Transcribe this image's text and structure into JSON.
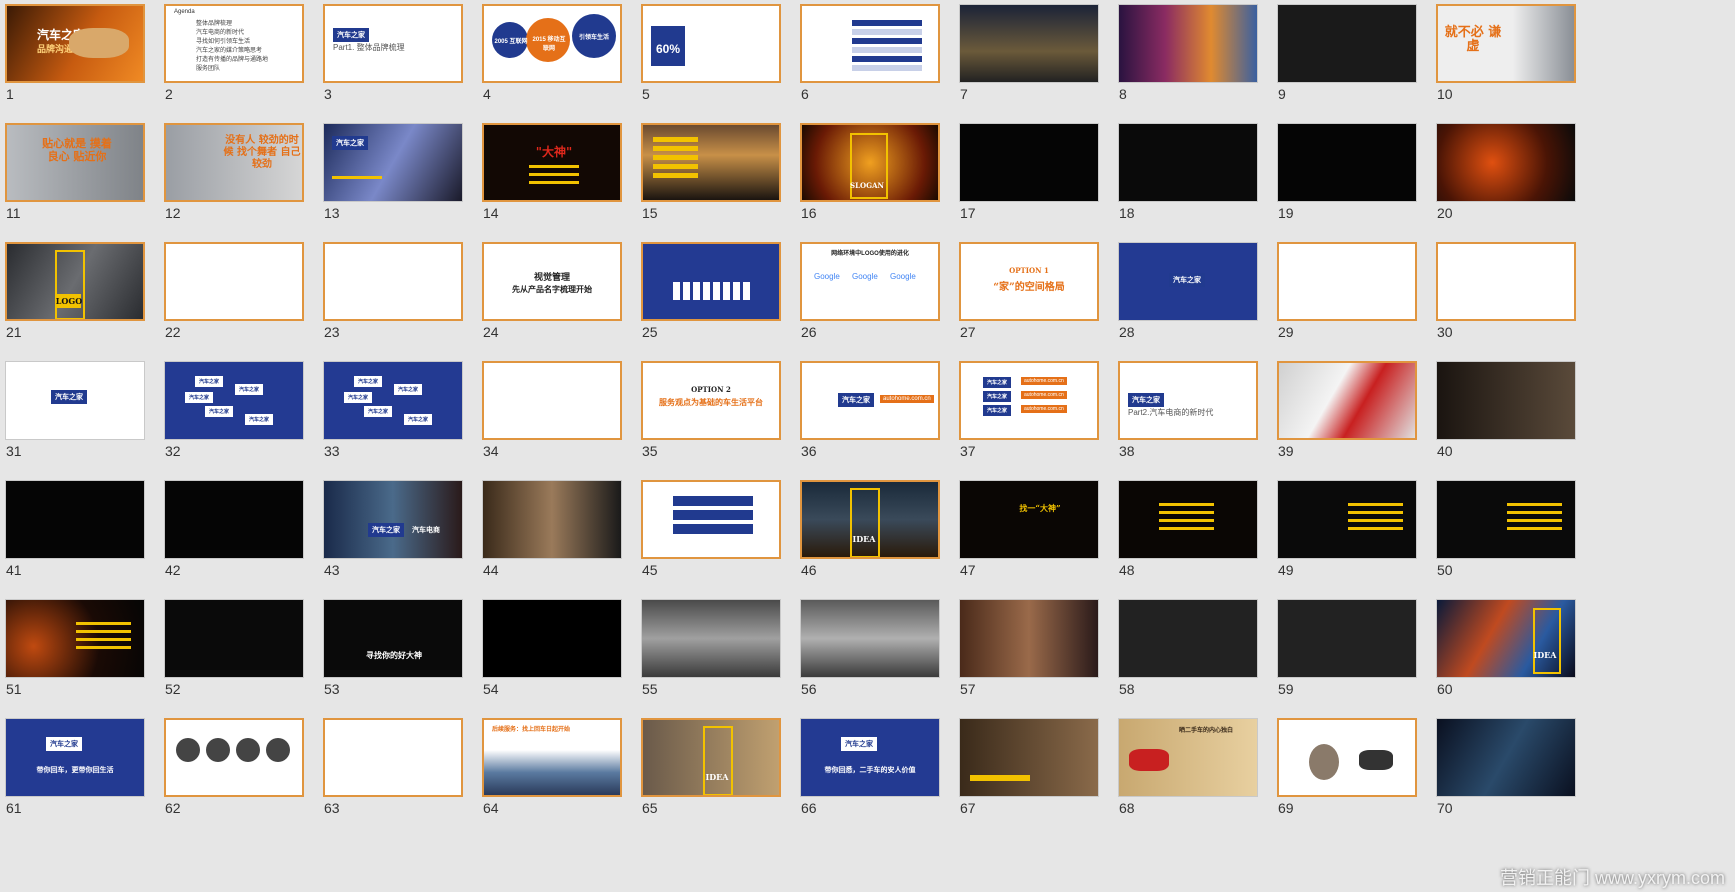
{
  "agenda": {
    "title": "Agenda",
    "items": [
      "整体品牌梳理",
      "汽车电商的新时代",
      "寻找如何引领车生活",
      "汽车之家的媒介策略思考",
      "打造有传播的品牌与通路地",
      "服务团队"
    ]
  },
  "slide_text": {
    "s1_title": "汽车之家",
    "s1_sub": "品牌沟通方案",
    "s3_part": "Part1. 整体品牌梳理",
    "s4_a": "2005 互联网",
    "s4_b": "2015 移动互联网",
    "s4_c": "引领车生活",
    "s5_big": "60%",
    "s10_big": "就不必 谦虚",
    "s11_big": "贴心就是 摸着良心 贴近你",
    "s12_big": "没有人 较劲的时候 找个舞者 自己较劲",
    "s14_big": "\"大神\"",
    "s16_big": "SLOGAN",
    "s21_big": "LOGO",
    "s24_line1": "视觉管理",
    "s24_line2": "先从产品名字梳理开始",
    "s26_title": "网络环境中LOGO使用的进化",
    "s26_google": "Google",
    "s27_opt": "OPTION 1",
    "s27_sub": "“家”的空间格局",
    "s35_opt": "OPTION 2",
    "s35_sub": "服务观点为基础的车生活平台",
    "s38_part": "Part2.汽车电商的新时代",
    "s43_tag": "汽车电商",
    "s46_big": "IDEA",
    "s47_big": "找一“大神”",
    "s53_big": "寻找你的好大神",
    "s60_big": "IDEA",
    "s61_tag": "带你回车，更带你回生活",
    "s64_title": "后续服务：找上回车日起开始",
    "s65_big": "IDEA",
    "s66_tag": "带你回悉，二手车的安人价值",
    "s68_title": "晒二手车的内心独白",
    "logo_text": "汽车之家",
    "logo_sub": "autohome.com.cn"
  },
  "slides": [
    "1",
    "2",
    "3",
    "4",
    "5",
    "6",
    "7",
    "8",
    "9",
    "10",
    "11",
    "12",
    "13",
    "14",
    "15",
    "16",
    "17",
    "18",
    "19",
    "20",
    "21",
    "22",
    "23",
    "24",
    "25",
    "26",
    "27",
    "28",
    "29",
    "30",
    "31",
    "32",
    "33",
    "34",
    "35",
    "36",
    "37",
    "38",
    "39",
    "40",
    "41",
    "42",
    "43",
    "44",
    "45",
    "46",
    "47",
    "48",
    "49",
    "50",
    "51",
    "52",
    "53",
    "54",
    "55",
    "56",
    "57",
    "58",
    "59",
    "60",
    "61",
    "62",
    "63",
    "64",
    "65",
    "66",
    "67",
    "68",
    "69",
    "70"
  ],
  "watermark": "营销正能门 www.yxrym.com"
}
